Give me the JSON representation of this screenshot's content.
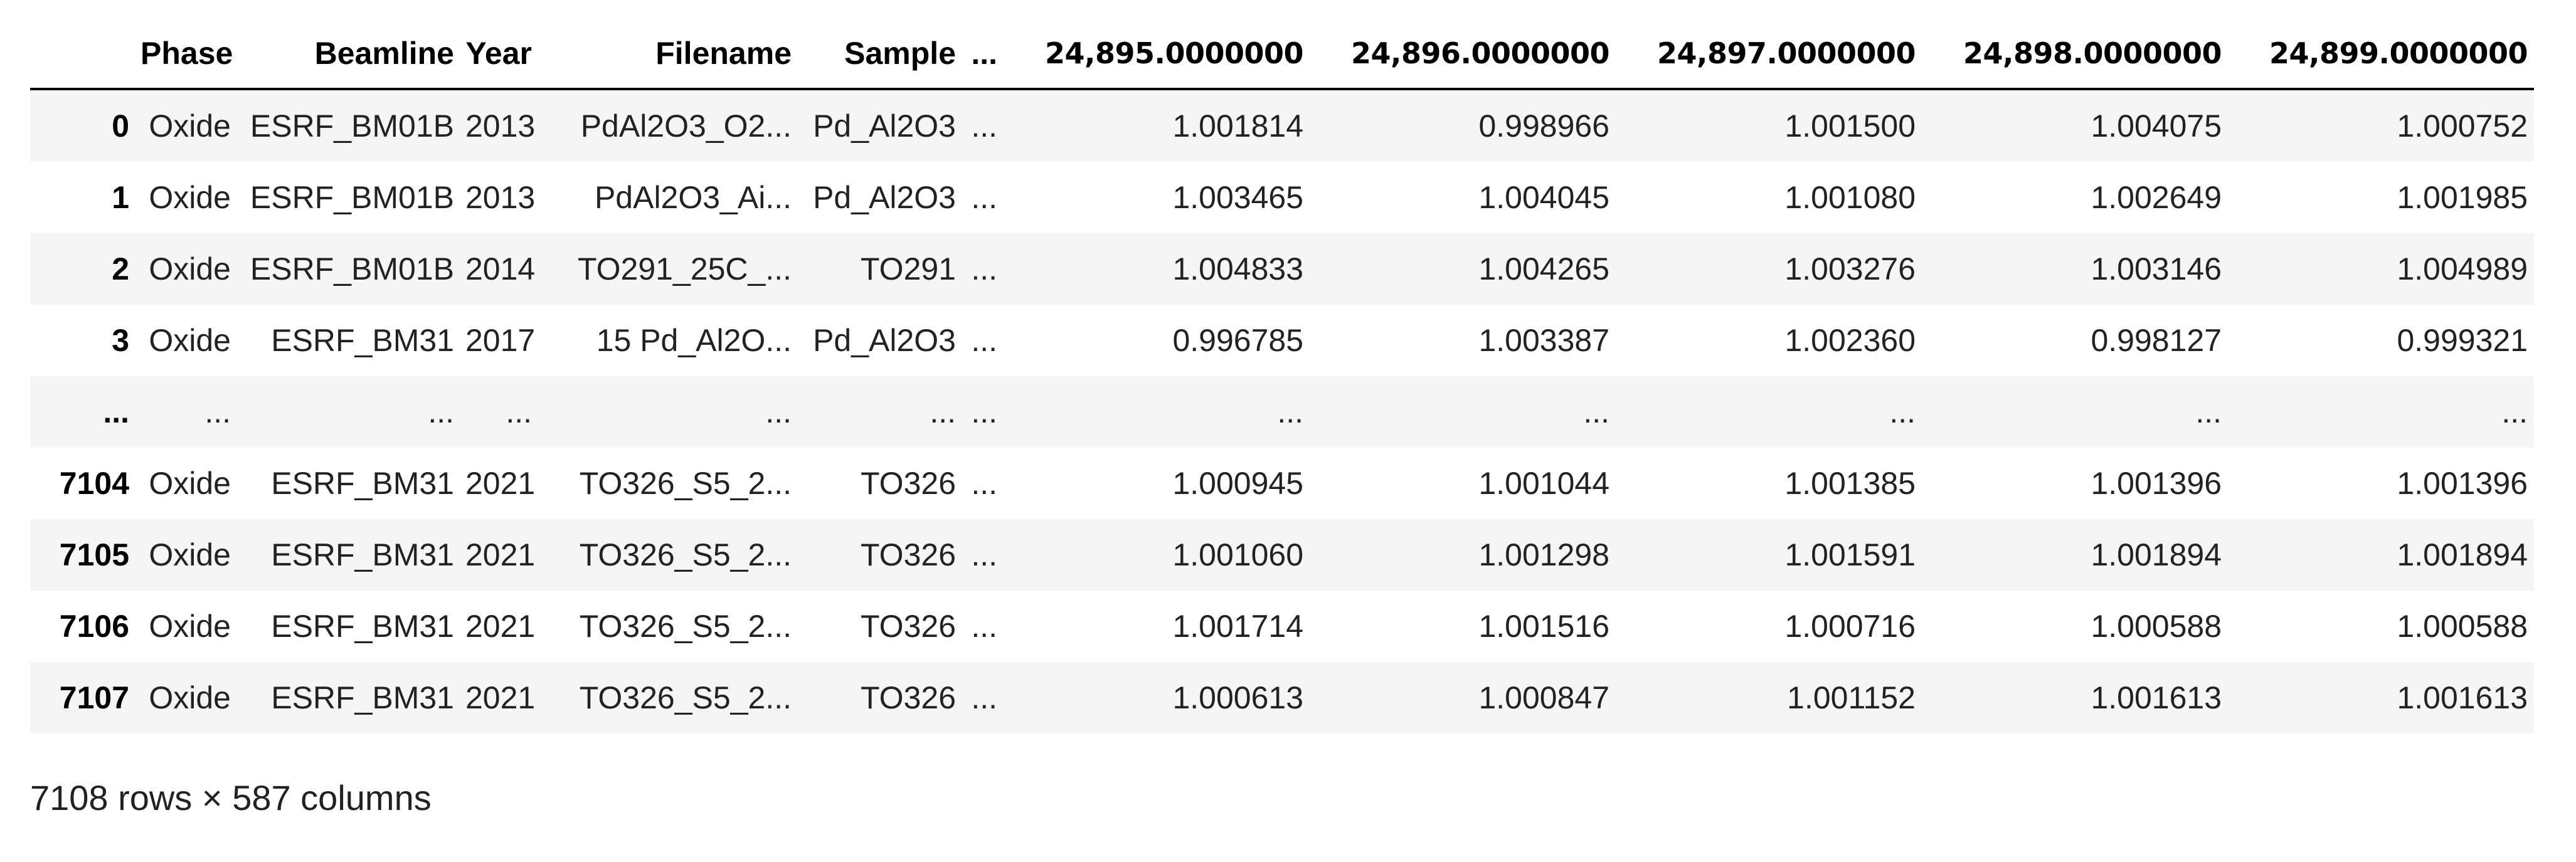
{
  "dataframe": {
    "columns": [
      "",
      "Phase",
      "Beamline",
      "Year",
      "Filename",
      "Sample",
      "...",
      "24,895.0000000",
      "24,896.0000000",
      "24,897.0000000",
      "24,898.0000000",
      "24,899.0000000"
    ],
    "rows": [
      {
        "index": "0",
        "cells": [
          "Oxide",
          "ESRF_BM01B",
          "2013",
          "PdAl2O3_O2...",
          "Pd_Al2O3",
          "...",
          "1.001814",
          "0.998966",
          "1.001500",
          "1.004075",
          "1.000752"
        ]
      },
      {
        "index": "1",
        "cells": [
          "Oxide",
          "ESRF_BM01B",
          "2013",
          "PdAl2O3_Ai...",
          "Pd_Al2O3",
          "...",
          "1.003465",
          "1.004045",
          "1.001080",
          "1.002649",
          "1.001985"
        ]
      },
      {
        "index": "2",
        "cells": [
          "Oxide",
          "ESRF_BM01B",
          "2014",
          "TO291_25C_...",
          "TO291",
          "...",
          "1.004833",
          "1.004265",
          "1.003276",
          "1.003146",
          "1.004989"
        ]
      },
      {
        "index": "3",
        "cells": [
          "Oxide",
          "ESRF_BM31",
          "2017",
          "15 Pd_Al2O...",
          "Pd_Al2O3",
          "...",
          "0.996785",
          "1.003387",
          "1.002360",
          "0.998127",
          "0.999321"
        ]
      },
      {
        "index": "...",
        "cells": [
          "...",
          "...",
          "...",
          "...",
          "...",
          "...",
          "...",
          "...",
          "...",
          "...",
          "..."
        ]
      },
      {
        "index": "7104",
        "cells": [
          "Oxide",
          "ESRF_BM31",
          "2021",
          "TO326_S5_2...",
          "TO326",
          "...",
          "1.000945",
          "1.001044",
          "1.001385",
          "1.001396",
          "1.001396"
        ]
      },
      {
        "index": "7105",
        "cells": [
          "Oxide",
          "ESRF_BM31",
          "2021",
          "TO326_S5_2...",
          "TO326",
          "...",
          "1.001060",
          "1.001298",
          "1.001591",
          "1.001894",
          "1.001894"
        ]
      },
      {
        "index": "7106",
        "cells": [
          "Oxide",
          "ESRF_BM31",
          "2021",
          "TO326_S5_2...",
          "TO326",
          "...",
          "1.001714",
          "1.001516",
          "1.000716",
          "1.000588",
          "1.000588"
        ]
      },
      {
        "index": "7107",
        "cells": [
          "Oxide",
          "ESRF_BM31",
          "2021",
          "TO326_S5_2...",
          "TO326",
          "...",
          "1.000613",
          "1.000847",
          "1.001152",
          "1.001613",
          "1.001613"
        ]
      }
    ],
    "shape_text": "7108 rows × 587 columns"
  },
  "colors": {
    "row_stripe": "#f5f5f5",
    "header_rule": "#000000"
  }
}
